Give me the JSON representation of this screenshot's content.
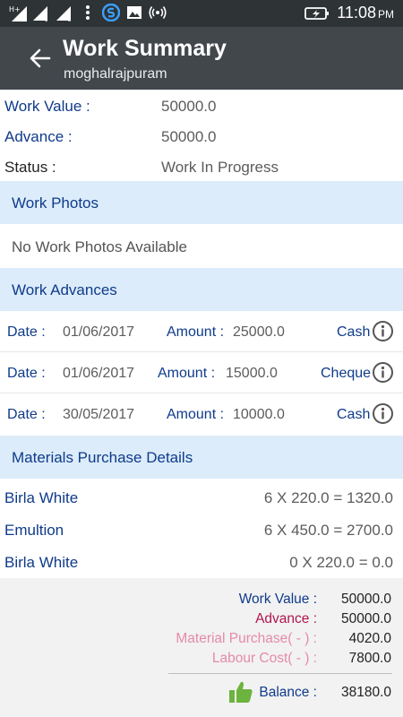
{
  "status_bar": {
    "time": "11:08",
    "ampm": "PM",
    "icons": [
      "hplus-signal-icon",
      "signal-sim1-icon",
      "signal-sim2-icon",
      "more-vert-icon",
      "app-s-icon",
      "image-icon",
      "hotspot-icon",
      "battery-charging-icon"
    ]
  },
  "toolbar": {
    "title": "Work Summary",
    "subtitle": "moghalrajpuram"
  },
  "info": {
    "work_value_label": "Work Value :",
    "work_value": "50000.0",
    "advance_label": "Advance :",
    "advance": "50000.0",
    "status_label": "Status :",
    "status": "Work In Progress"
  },
  "sections": {
    "photos": "Work Photos",
    "photos_empty": "No Work Photos Available",
    "advances": "Work Advances",
    "materials": "Materials Purchase Details"
  },
  "advances": [
    {
      "date_label": "Date :",
      "date": "01/06/2017",
      "amount_label": "Amount :",
      "amount": "25000.0",
      "mode": "Cash"
    },
    {
      "date_label": "Date :",
      "date": "01/06/2017",
      "amount_label": "Amount :",
      "amount": "15000.0",
      "mode": "Cheque"
    },
    {
      "date_label": "Date :",
      "date": "30/05/2017",
      "amount_label": "Amount :",
      "amount": "10000.0",
      "mode": "Cash"
    }
  ],
  "materials": [
    {
      "name": "Birla White",
      "calc": "6 X 220.0 = 1320.0"
    },
    {
      "name": "Emultion",
      "calc": "6 X 450.0 = 2700.0"
    },
    {
      "name": "Birla White",
      "calc": "0 X 220.0 = 0.0"
    }
  ],
  "summary": {
    "work_value_label": "Work Value :",
    "work_value": "50000.0",
    "advance_label": "Advance :",
    "advance": "50000.0",
    "material_label": "Material Purchase( - ) :",
    "material": "4020.0",
    "labour_label": "Labour Cost( - ) :",
    "labour": "7800.0",
    "balance_label": "Balance :",
    "balance": "38180.0"
  },
  "colors": {
    "toolbar": "#42474c",
    "status_bar": "#2e3335",
    "section_bg": "#dcecfa",
    "label_blue": "#0f3b8b",
    "advance_red": "#b0154f",
    "deduction_pink": "#e58aa8",
    "thumb_green": "#6cb33f"
  }
}
